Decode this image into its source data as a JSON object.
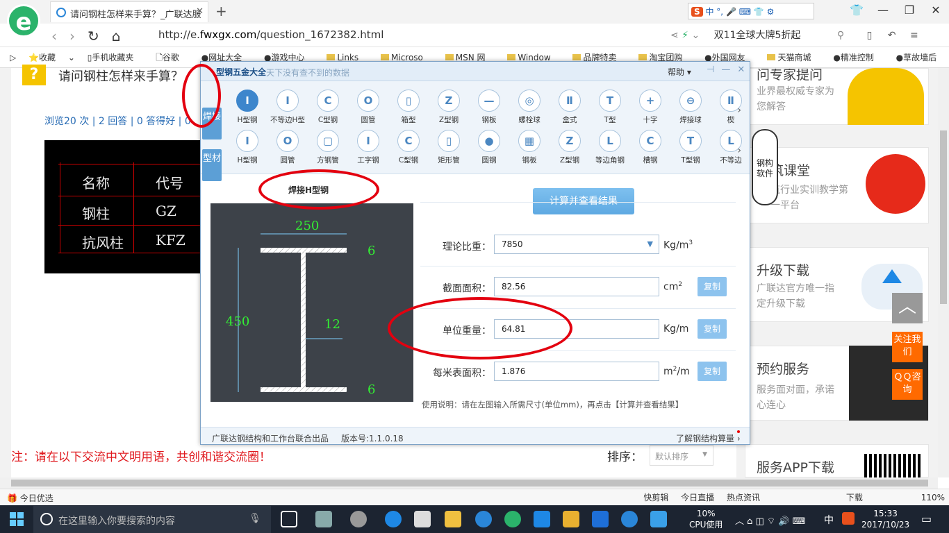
{
  "browser": {
    "tab_title": "请问钢柱怎样来手算？_广联达服",
    "url_prefix": "http://e.",
    "url_host": "fwxgx.com",
    "url_path": "/question_1672382.html",
    "promo": "双11全球大牌5折起",
    "ime_text": "中 °, ",
    "bookmarks": [
      "收藏",
      "手机收藏夹",
      "谷歌",
      "网址大全",
      "游戏中心",
      "Links",
      "Microso",
      "MSN 网",
      "Window",
      "品牌特卖",
      "淘宝团购",
      "外国网友",
      "天猫商城",
      "精准控制",
      "草故墙后"
    ]
  },
  "page": {
    "question_title": "请问钢柱怎样来手算？",
    "stats": "浏览20 次 | 2 回答 | 0 答得好 | 0",
    "note": "注：请在以下交流中文明用语，共创和谐交流圈！",
    "sort_label": "排序：",
    "sort_value": "默认排序",
    "cad_table": [
      [
        "名称",
        "代号"
      ],
      [
        "钢柱",
        "GZ"
      ],
      [
        "抗风柱",
        "KFZ"
      ]
    ]
  },
  "sidebar": {
    "c1": {
      "title": "问专家提问",
      "sub": "业界最权威专家为您解答"
    },
    "c2": {
      "title": "筑课堂",
      "sub": "筑行业实训教学第一平台"
    },
    "c3": {
      "title": "升级下载",
      "sub": "广联达官方唯一指定升级下载"
    },
    "c4": {
      "title": "预约服务",
      "sub": "服务面对面，承诺心连心"
    },
    "c5": {
      "title": "服务APP下载"
    },
    "badge": "钢构软件",
    "totop": "︿",
    "follow": "关注我们",
    "qq": "ＱＱ咨询"
  },
  "app": {
    "name": "型钢五金大全",
    "slogan": "天下没有查不到的数据",
    "help": "帮助",
    "tab_weld": "焊接",
    "tab_section": "型材",
    "row1": [
      "H型钢",
      "不等边H型",
      "C型钢",
      "圆管",
      "箱型",
      "Z型钢",
      "钢板",
      "螺栓球",
      "盒式",
      "T型",
      "十字",
      "焊接球",
      "楔"
    ],
    "row1_icons": [
      "I",
      "I",
      "C",
      "O",
      "▯",
      "Z",
      "—",
      "◎",
      "Ⅱ",
      "T",
      "+",
      "⊖",
      "Ⅱ"
    ],
    "row2": [
      "H型钢",
      "圆管",
      "方钢管",
      "工字钢",
      "C型钢",
      "矩形管",
      "圆钢",
      "钢板",
      "Z型钢",
      "等边角钢",
      "槽钢",
      "T型钢",
      "不等边"
    ],
    "row2_icons": [
      "I",
      "O",
      "▢",
      "I",
      "C",
      "▯",
      "●",
      "▦",
      "Z",
      "L",
      "C",
      "T",
      "L"
    ],
    "diagram_label": "焊接H型钢",
    "calc_button": "计算并查看结果",
    "dims": {
      "width": "250",
      "height": "450",
      "flange_top": "6",
      "flange_bottom": "6",
      "web": "12"
    },
    "fields": {
      "density": {
        "label": "理论比重：",
        "value": "7850",
        "unit": "Kg/m",
        "sup": "3"
      },
      "area": {
        "label": "截面面积：",
        "value": "82.56",
        "unit": "cm",
        "sup": "2",
        "copy": "复制"
      },
      "weight": {
        "label": "单位重量：",
        "value": "64.81",
        "unit": "Kg/m",
        "copy": "复制"
      },
      "surface": {
        "label": "每米表面积：",
        "value": "1.876",
        "unit": "m",
        "unit2": "/m",
        "sup": "2",
        "copy": "复制"
      }
    },
    "usage": "使用说明：请在左图输入所需尺寸(单位mm)，再点击【计算并查看结果】",
    "footer_left": "广联达钢结构和工作台联合出品",
    "footer_version": "版本号:1.1.0.18",
    "footer_right": "了解钢结构算量"
  },
  "status": {
    "left": "今日优选",
    "items": [
      "快剪辑",
      "今日直播",
      "热点资讯",
      "下载",
      "110%"
    ]
  },
  "taskbar": {
    "search_placeholder": "在这里输入你要搜索的内容",
    "cpu_value": "10%",
    "cpu_label": "CPU使用",
    "ime": "中",
    "time": "15:33",
    "date": "2017/10/23"
  }
}
